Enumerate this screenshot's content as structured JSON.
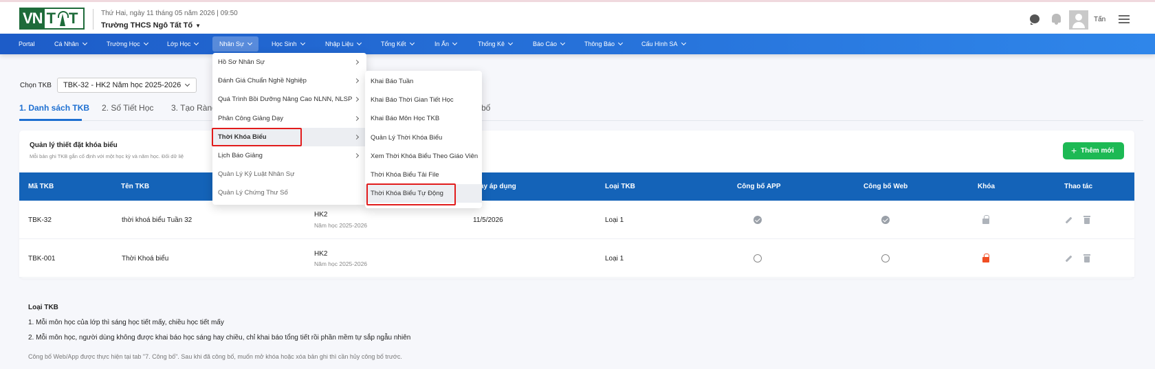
{
  "header": {
    "logo_text": "VNTT",
    "date": "Thứ Hai, ngày 11 tháng 05 năm 2026 | 09:50",
    "school": "Trường THCS Ngô Tất Tố",
    "user": "Tấn"
  },
  "nav": {
    "items": [
      {
        "label": "Portal",
        "chev": false
      },
      {
        "label": "Cá Nhân",
        "chev": true
      },
      {
        "label": "Trường Học",
        "chev": true
      },
      {
        "label": "Lớp Học",
        "chev": true
      },
      {
        "label": "Nhân Sự",
        "chev": true
      },
      {
        "label": "Học Sinh",
        "chev": true
      },
      {
        "label": "Nhập Liệu",
        "chev": true
      },
      {
        "label": "Tổng Kết",
        "chev": true
      },
      {
        "label": "In Ấn",
        "chev": true
      },
      {
        "label": "Thống Kê",
        "chev": true
      },
      {
        "label": "Báo Cáo",
        "chev": true
      },
      {
        "label": "Thông Báo",
        "chev": true
      },
      {
        "label": "Cấu Hình SA",
        "chev": true
      }
    ]
  },
  "page": {
    "choose_label": "Chọn TKB",
    "choose_value": "TBK-32 - HK2 Năm học 2025-2026",
    "tabs": [
      "1. Danh sách TKB",
      "2. Số Tiết Học",
      "3. Tạo Ràng",
      "bố"
    ]
  },
  "card": {
    "title": "Quản lý thiết đặt khóa biểu",
    "desc": "Mỗi bản ghi TKB gắn cố định với một học kỳ và năm học. Đối dữ liệ",
    "add_button": "Thêm mới"
  },
  "table": {
    "headers": [
      "Mã TKB",
      "Tên TKB",
      "ày áp dụng",
      "Loại TKB",
      "Công bố APP",
      "Công bố Web",
      "Khóa",
      "Thao tác"
    ],
    "rows": [
      {
        "code": "TBK-32",
        "name": "thời khoá biểu Tuần 32",
        "term": "HK2",
        "year": "Năm học 2025-2026",
        "date": "11/5/2026",
        "type": "Loại 1",
        "app": "checked",
        "web": "checked",
        "lock": "gray"
      },
      {
        "code": "TBK-001",
        "name": "Thời Khoá biểu",
        "term": "HK2",
        "year": "Năm học 2025-2026",
        "date": "",
        "type": "Loại 1",
        "app": "empty",
        "web": "empty",
        "lock": "red"
      }
    ]
  },
  "notes": {
    "title": "Loại TKB",
    "line1": "1. Mỗi môn học của lớp thì sáng học tiết mấy, chiều học tiết mấy",
    "line2": "2. Mỗi môn học, người dùng không được khai báo học sáng hay chiều, chỉ khai báo tổng tiết rồi phần mềm tự sắp ngẫu nhiên",
    "footer": "Công bố Web/App được thực hiện tại tab \"7. Công bố\". Sau khi đã công bố, muốn mở khóa hoặc xóa bản ghi thì cần hủy công bố trước."
  },
  "menu_nhan_su": {
    "items": [
      {
        "label": "Hồ Sơ Nhân Sự",
        "arrow": true
      },
      {
        "label": "Đánh Giá Chuẩn Nghề Nghiệp",
        "arrow": true
      },
      {
        "label": "Quá Trình Bồi Dưỡng Nâng Cao NLNN, NLSP",
        "arrow": true
      },
      {
        "label": "Phân Công Giảng Dạy",
        "arrow": true
      },
      {
        "label": "Thời Khóa Biểu",
        "arrow": true
      },
      {
        "label": "Lịch Báo Giảng",
        "arrow": true
      },
      {
        "label": "Quản Lý Kỷ Luật Nhân Sự",
        "arrow": false
      },
      {
        "label": "Quản Lý Chứng Thư Số",
        "arrow": false
      }
    ]
  },
  "menu_tkb": {
    "items": [
      "Khai Báo Tuần",
      "Khai Báo Thời Gian Tiết Học",
      "Khai Báo Môn Học TKB",
      "Quản Lý Thời Khóa Biểu",
      "Xem Thời Khóa Biểu Theo Giáo Viên",
      "Thời Khóa Biểu Tải File",
      "Thời Khóa Biểu Tự Động"
    ]
  }
}
